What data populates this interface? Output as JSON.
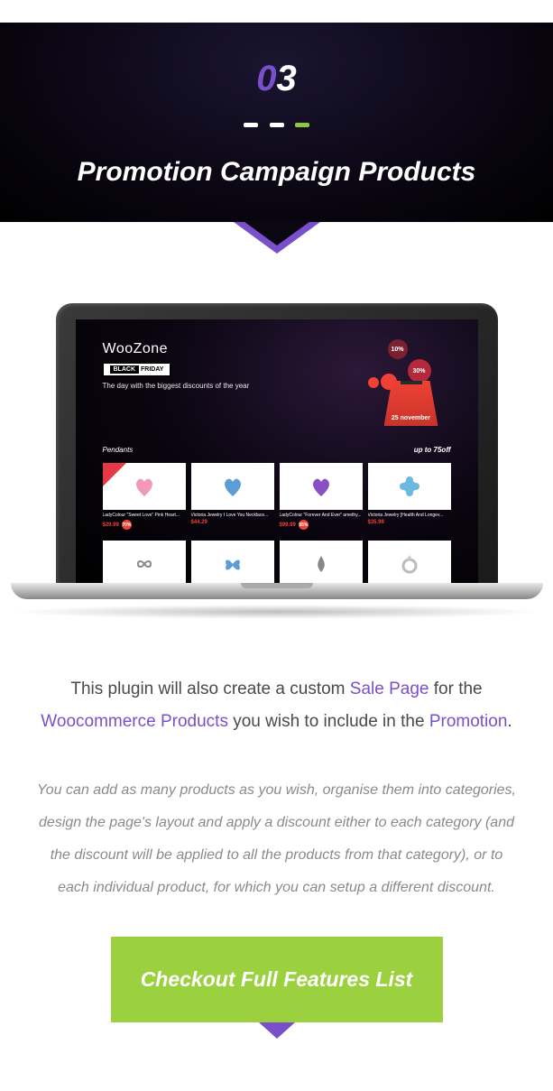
{
  "hero": {
    "step_first": "0",
    "step_second": "3",
    "title": "Promotion Campaign Products"
  },
  "laptop_screen": {
    "logo_woo": "Woo",
    "logo_zone": "Zone",
    "badge_black": "BLACK",
    "badge_friday": "FRIDAY",
    "tagline": "The day with the biggest discounts of the year",
    "bubbles": {
      "b1": "10%",
      "b2": "30%",
      "b3": ""
    },
    "calendar_date": "25 november",
    "category_name": "Pendants",
    "category_discount_label": "up to",
    "category_discount_value": "75off",
    "products_row1": [
      {
        "title": "LadyColour \"Sweet Love\" Pink Heart...",
        "price": "$29.99",
        "discount": "70%",
        "old": ""
      },
      {
        "title": "Victoria Jewelry I Love You Necklace...",
        "price": "$44.29",
        "discount": "",
        "old": ""
      },
      {
        "title": "LadyColour \"Forever And Ever\" amethy...",
        "price": "$99.99",
        "discount": "55%",
        "old": ""
      },
      {
        "title": "Victoria Jewelry [Health And Longev...",
        "price": "$35.99",
        "discount": "",
        "old": ""
      }
    ]
  },
  "body": {
    "p1_part1": "This plugin will also create a custom ",
    "p1_hl1": "Sale Page",
    "p1_part2": " for the ",
    "p1_hl2": "Woocommerce Products",
    "p1_part3": " you wish to include in the ",
    "p1_hl3": "Promotion",
    "p1_part4": ".",
    "p2": "You can add as many products as you wish, organise them into categories, design the page's layout and apply a discount either to each category (and the discount will be applied to all the products from that category), or to each individual product, for which you can setup a different discount."
  },
  "cta": {
    "label": "Checkout Full Features List"
  }
}
